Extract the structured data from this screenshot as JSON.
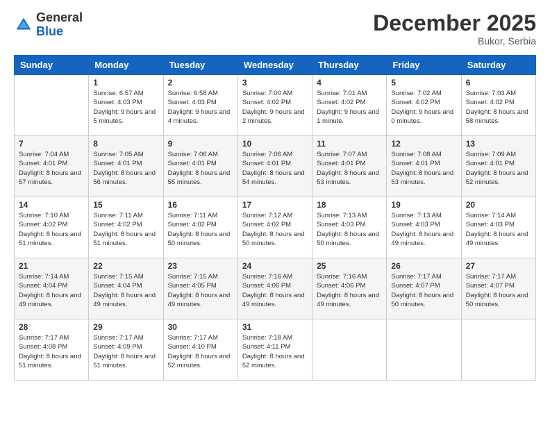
{
  "header": {
    "logo_general": "General",
    "logo_blue": "Blue",
    "month_title": "December 2025",
    "location": "Bukor, Serbia"
  },
  "weekdays": [
    "Sunday",
    "Monday",
    "Tuesday",
    "Wednesday",
    "Thursday",
    "Friday",
    "Saturday"
  ],
  "weeks": [
    [
      {
        "day": "",
        "sunrise": "",
        "sunset": "",
        "daylight": ""
      },
      {
        "day": "1",
        "sunrise": "Sunrise: 6:57 AM",
        "sunset": "Sunset: 4:03 PM",
        "daylight": "Daylight: 9 hours and 5 minutes."
      },
      {
        "day": "2",
        "sunrise": "Sunrise: 6:58 AM",
        "sunset": "Sunset: 4:03 PM",
        "daylight": "Daylight: 9 hours and 4 minutes."
      },
      {
        "day": "3",
        "sunrise": "Sunrise: 7:00 AM",
        "sunset": "Sunset: 4:02 PM",
        "daylight": "Daylight: 9 hours and 2 minutes."
      },
      {
        "day": "4",
        "sunrise": "Sunrise: 7:01 AM",
        "sunset": "Sunset: 4:02 PM",
        "daylight": "Daylight: 9 hours and 1 minute."
      },
      {
        "day": "5",
        "sunrise": "Sunrise: 7:02 AM",
        "sunset": "Sunset: 4:02 PM",
        "daylight": "Daylight: 9 hours and 0 minutes."
      },
      {
        "day": "6",
        "sunrise": "Sunrise: 7:03 AM",
        "sunset": "Sunset: 4:02 PM",
        "daylight": "Daylight: 8 hours and 58 minutes."
      }
    ],
    [
      {
        "day": "7",
        "sunrise": "Sunrise: 7:04 AM",
        "sunset": "Sunset: 4:01 PM",
        "daylight": "Daylight: 8 hours and 57 minutes."
      },
      {
        "day": "8",
        "sunrise": "Sunrise: 7:05 AM",
        "sunset": "Sunset: 4:01 PM",
        "daylight": "Daylight: 8 hours and 56 minutes."
      },
      {
        "day": "9",
        "sunrise": "Sunrise: 7:06 AM",
        "sunset": "Sunset: 4:01 PM",
        "daylight": "Daylight: 8 hours and 55 minutes."
      },
      {
        "day": "10",
        "sunrise": "Sunrise: 7:06 AM",
        "sunset": "Sunset: 4:01 PM",
        "daylight": "Daylight: 8 hours and 54 minutes."
      },
      {
        "day": "11",
        "sunrise": "Sunrise: 7:07 AM",
        "sunset": "Sunset: 4:01 PM",
        "daylight": "Daylight: 8 hours and 53 minutes."
      },
      {
        "day": "12",
        "sunrise": "Sunrise: 7:08 AM",
        "sunset": "Sunset: 4:01 PM",
        "daylight": "Daylight: 8 hours and 53 minutes."
      },
      {
        "day": "13",
        "sunrise": "Sunrise: 7:09 AM",
        "sunset": "Sunset: 4:01 PM",
        "daylight": "Daylight: 8 hours and 52 minutes."
      }
    ],
    [
      {
        "day": "14",
        "sunrise": "Sunrise: 7:10 AM",
        "sunset": "Sunset: 4:02 PM",
        "daylight": "Daylight: 8 hours and 51 minutes."
      },
      {
        "day": "15",
        "sunrise": "Sunrise: 7:11 AM",
        "sunset": "Sunset: 4:02 PM",
        "daylight": "Daylight: 8 hours and 51 minutes."
      },
      {
        "day": "16",
        "sunrise": "Sunrise: 7:11 AM",
        "sunset": "Sunset: 4:02 PM",
        "daylight": "Daylight: 8 hours and 50 minutes."
      },
      {
        "day": "17",
        "sunrise": "Sunrise: 7:12 AM",
        "sunset": "Sunset: 4:02 PM",
        "daylight": "Daylight: 8 hours and 50 minutes."
      },
      {
        "day": "18",
        "sunrise": "Sunrise: 7:13 AM",
        "sunset": "Sunset: 4:03 PM",
        "daylight": "Daylight: 8 hours and 50 minutes."
      },
      {
        "day": "19",
        "sunrise": "Sunrise: 7:13 AM",
        "sunset": "Sunset: 4:03 PM",
        "daylight": "Daylight: 8 hours and 49 minutes."
      },
      {
        "day": "20",
        "sunrise": "Sunrise: 7:14 AM",
        "sunset": "Sunset: 4:03 PM",
        "daylight": "Daylight: 8 hours and 49 minutes."
      }
    ],
    [
      {
        "day": "21",
        "sunrise": "Sunrise: 7:14 AM",
        "sunset": "Sunset: 4:04 PM",
        "daylight": "Daylight: 8 hours and 49 minutes."
      },
      {
        "day": "22",
        "sunrise": "Sunrise: 7:15 AM",
        "sunset": "Sunset: 4:04 PM",
        "daylight": "Daylight: 8 hours and 49 minutes."
      },
      {
        "day": "23",
        "sunrise": "Sunrise: 7:15 AM",
        "sunset": "Sunset: 4:05 PM",
        "daylight": "Daylight: 8 hours and 49 minutes."
      },
      {
        "day": "24",
        "sunrise": "Sunrise: 7:16 AM",
        "sunset": "Sunset: 4:06 PM",
        "daylight": "Daylight: 8 hours and 49 minutes."
      },
      {
        "day": "25",
        "sunrise": "Sunrise: 7:16 AM",
        "sunset": "Sunset: 4:06 PM",
        "daylight": "Daylight: 8 hours and 49 minutes."
      },
      {
        "day": "26",
        "sunrise": "Sunrise: 7:17 AM",
        "sunset": "Sunset: 4:07 PM",
        "daylight": "Daylight: 8 hours and 50 minutes."
      },
      {
        "day": "27",
        "sunrise": "Sunrise: 7:17 AM",
        "sunset": "Sunset: 4:07 PM",
        "daylight": "Daylight: 8 hours and 50 minutes."
      }
    ],
    [
      {
        "day": "28",
        "sunrise": "Sunrise: 7:17 AM",
        "sunset": "Sunset: 4:08 PM",
        "daylight": "Daylight: 8 hours and 51 minutes."
      },
      {
        "day": "29",
        "sunrise": "Sunrise: 7:17 AM",
        "sunset": "Sunset: 4:09 PM",
        "daylight": "Daylight: 8 hours and 51 minutes."
      },
      {
        "day": "30",
        "sunrise": "Sunrise: 7:17 AM",
        "sunset": "Sunset: 4:10 PM",
        "daylight": "Daylight: 8 hours and 52 minutes."
      },
      {
        "day": "31",
        "sunrise": "Sunrise: 7:18 AM",
        "sunset": "Sunset: 4:11 PM",
        "daylight": "Daylight: 8 hours and 52 minutes."
      },
      {
        "day": "",
        "sunrise": "",
        "sunset": "",
        "daylight": ""
      },
      {
        "day": "",
        "sunrise": "",
        "sunset": "",
        "daylight": ""
      },
      {
        "day": "",
        "sunrise": "",
        "sunset": "",
        "daylight": ""
      }
    ]
  ]
}
